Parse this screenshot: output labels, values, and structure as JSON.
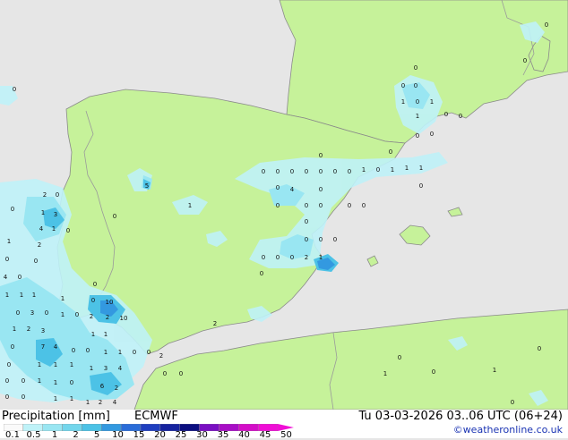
{
  "footer": {
    "title": "Precipitation [mm]",
    "model": "ECMWF",
    "valid": "Tu 03-03-2026 03..06 UTC (06+24)",
    "credit": "©weatheronline.co.uk"
  },
  "legend": {
    "ticks": [
      "0.1",
      "0.5",
      "1",
      "2",
      "5",
      "10",
      "15",
      "20",
      "25",
      "30",
      "35",
      "40",
      "45",
      "50"
    ],
    "colors": [
      "#fafafa",
      "#bff2f8",
      "#99e6f2",
      "#73d6ec",
      "#4cc2e6",
      "#3399e0",
      "#2a6cd8",
      "#1f3fbf",
      "#16239f",
      "#0c0f80",
      "#7a0fc2",
      "#a80ec6",
      "#d40ec8",
      "#f00ed6"
    ]
  },
  "map": {
    "colors": {
      "sea": "#e6e6e6",
      "land": "#c6f29a",
      "border": "#9a9a9a",
      "coast": "#8a8a8a",
      "precip_light": "#bff2f8",
      "precip_mid": "#99e6f2",
      "precip_heavy": "#3399e0"
    },
    "point_labels": [
      "0",
      "2",
      "1",
      "4",
      "5",
      "3",
      "6",
      "7",
      "10"
    ]
  }
}
